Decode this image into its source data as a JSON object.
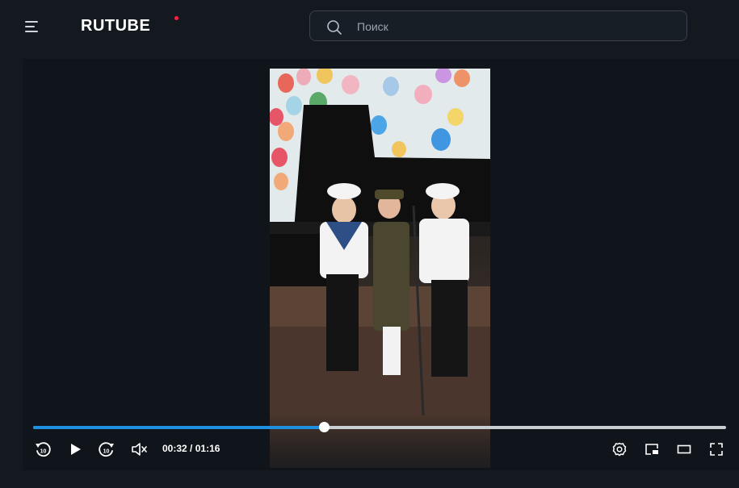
{
  "header": {
    "logo_text": "RUTUBE",
    "menu_icon": "hamburger-icon",
    "search": {
      "placeholder": "Поиск",
      "value": "",
      "icon": "search-icon"
    }
  },
  "player": {
    "current_time": "00:32",
    "separator": "/",
    "duration": "01:16",
    "progress_fraction": 0.42,
    "accent_color": "#1f8fe0",
    "brand_dot_color": "#ff1e46",
    "controls": [
      {
        "name": "rewind-10",
        "icon": "rewind-10-icon"
      },
      {
        "name": "play",
        "icon": "play-icon"
      },
      {
        "name": "forward-10",
        "icon": "forward-10-icon"
      },
      {
        "name": "mute",
        "icon": "volume-muted-icon"
      },
      {
        "name": "settings",
        "icon": "gear-icon"
      },
      {
        "name": "picture-in-picture",
        "icon": "pip-icon"
      },
      {
        "name": "theater-mode",
        "icon": "theater-icon"
      },
      {
        "name": "fullscreen",
        "icon": "fullscreen-icon"
      }
    ]
  }
}
